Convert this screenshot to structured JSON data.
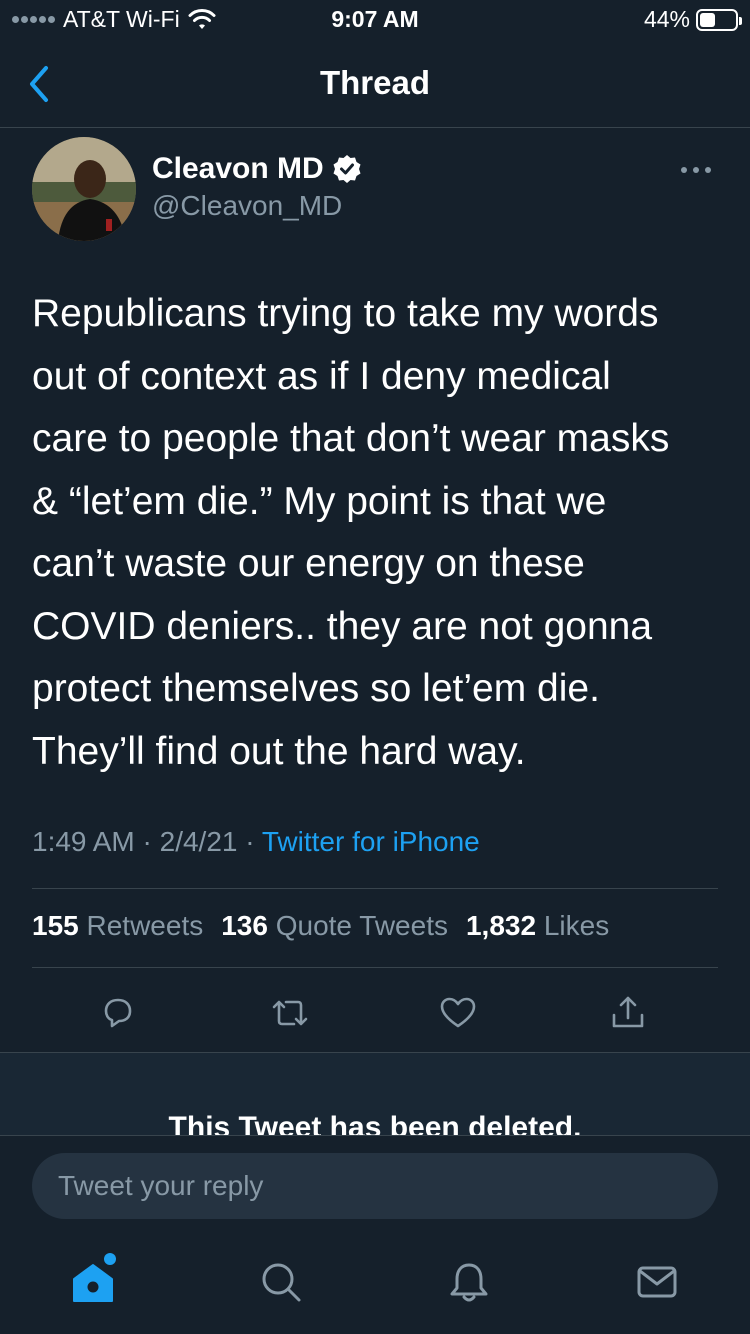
{
  "status_bar": {
    "carrier": "AT&T Wi-Fi",
    "time": "9:07 AM",
    "battery": "44%",
    "battery_level": 0.44
  },
  "header": {
    "title": "Thread",
    "back_icon": "chevron-left-icon"
  },
  "tweet": {
    "display_name": "Cleavon MD",
    "handle": "@Cleavon_MD",
    "verified_icon": "verified-badge-icon",
    "more_icon": "more-icon",
    "text": "Republicans trying to take my words\nout of context as if I deny medical\ncare to people that don’t wear masks\n& “let’em die.” My point is that we\ncan’t waste our energy on these\nCOVID deniers.. they are not gonna\nprotect themselves so let’em die.\nThey’ll find out the hard way.",
    "time": "1:49 AM",
    "date": "2/4/21",
    "separator": "·",
    "source": "Twitter for iPhone"
  },
  "stats": {
    "retweets_count": "155",
    "retweets_label": "Retweets",
    "quotes_count": "136",
    "quotes_label": "Quote Tweets",
    "likes_count": "1,832",
    "likes_label": "Likes"
  },
  "actions": [
    "reply-icon",
    "retweet-icon",
    "like-icon",
    "share-icon"
  ],
  "deleted_notice": "This Tweet has been deleted.",
  "reply": {
    "placeholder": "Tweet your reply"
  },
  "tab_bar": [
    "home-icon",
    "search-icon",
    "notifications-icon",
    "messages-icon"
  ],
  "colors": {
    "background": "#15202b",
    "accent": "#1da1f2",
    "secondary_text": "#8899a6",
    "border": "#38444d"
  }
}
